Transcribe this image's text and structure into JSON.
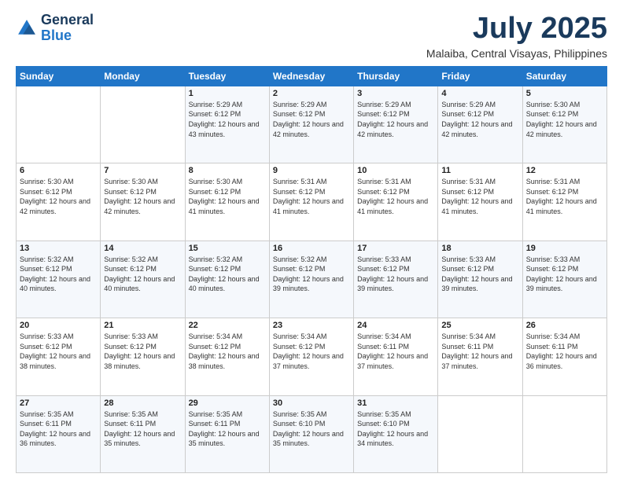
{
  "logo": {
    "text_general": "General",
    "text_blue": "Blue"
  },
  "title": "July 2025",
  "location": "Malaiba, Central Visayas, Philippines",
  "days_of_week": [
    "Sunday",
    "Monday",
    "Tuesday",
    "Wednesday",
    "Thursday",
    "Friday",
    "Saturday"
  ],
  "weeks": [
    [
      {
        "day": "",
        "sunrise": "",
        "sunset": "",
        "daylight": ""
      },
      {
        "day": "",
        "sunrise": "",
        "sunset": "",
        "daylight": ""
      },
      {
        "day": "1",
        "sunrise": "Sunrise: 5:29 AM",
        "sunset": "Sunset: 6:12 PM",
        "daylight": "Daylight: 12 hours and 43 minutes."
      },
      {
        "day": "2",
        "sunrise": "Sunrise: 5:29 AM",
        "sunset": "Sunset: 6:12 PM",
        "daylight": "Daylight: 12 hours and 42 minutes."
      },
      {
        "day": "3",
        "sunrise": "Sunrise: 5:29 AM",
        "sunset": "Sunset: 6:12 PM",
        "daylight": "Daylight: 12 hours and 42 minutes."
      },
      {
        "day": "4",
        "sunrise": "Sunrise: 5:29 AM",
        "sunset": "Sunset: 6:12 PM",
        "daylight": "Daylight: 12 hours and 42 minutes."
      },
      {
        "day": "5",
        "sunrise": "Sunrise: 5:30 AM",
        "sunset": "Sunset: 6:12 PM",
        "daylight": "Daylight: 12 hours and 42 minutes."
      }
    ],
    [
      {
        "day": "6",
        "sunrise": "Sunrise: 5:30 AM",
        "sunset": "Sunset: 6:12 PM",
        "daylight": "Daylight: 12 hours and 42 minutes."
      },
      {
        "day": "7",
        "sunrise": "Sunrise: 5:30 AM",
        "sunset": "Sunset: 6:12 PM",
        "daylight": "Daylight: 12 hours and 42 minutes."
      },
      {
        "day": "8",
        "sunrise": "Sunrise: 5:30 AM",
        "sunset": "Sunset: 6:12 PM",
        "daylight": "Daylight: 12 hours and 41 minutes."
      },
      {
        "day": "9",
        "sunrise": "Sunrise: 5:31 AM",
        "sunset": "Sunset: 6:12 PM",
        "daylight": "Daylight: 12 hours and 41 minutes."
      },
      {
        "day": "10",
        "sunrise": "Sunrise: 5:31 AM",
        "sunset": "Sunset: 6:12 PM",
        "daylight": "Daylight: 12 hours and 41 minutes."
      },
      {
        "day": "11",
        "sunrise": "Sunrise: 5:31 AM",
        "sunset": "Sunset: 6:12 PM",
        "daylight": "Daylight: 12 hours and 41 minutes."
      },
      {
        "day": "12",
        "sunrise": "Sunrise: 5:31 AM",
        "sunset": "Sunset: 6:12 PM",
        "daylight": "Daylight: 12 hours and 41 minutes."
      }
    ],
    [
      {
        "day": "13",
        "sunrise": "Sunrise: 5:32 AM",
        "sunset": "Sunset: 6:12 PM",
        "daylight": "Daylight: 12 hours and 40 minutes."
      },
      {
        "day": "14",
        "sunrise": "Sunrise: 5:32 AM",
        "sunset": "Sunset: 6:12 PM",
        "daylight": "Daylight: 12 hours and 40 minutes."
      },
      {
        "day": "15",
        "sunrise": "Sunrise: 5:32 AM",
        "sunset": "Sunset: 6:12 PM",
        "daylight": "Daylight: 12 hours and 40 minutes."
      },
      {
        "day": "16",
        "sunrise": "Sunrise: 5:32 AM",
        "sunset": "Sunset: 6:12 PM",
        "daylight": "Daylight: 12 hours and 39 minutes."
      },
      {
        "day": "17",
        "sunrise": "Sunrise: 5:33 AM",
        "sunset": "Sunset: 6:12 PM",
        "daylight": "Daylight: 12 hours and 39 minutes."
      },
      {
        "day": "18",
        "sunrise": "Sunrise: 5:33 AM",
        "sunset": "Sunset: 6:12 PM",
        "daylight": "Daylight: 12 hours and 39 minutes."
      },
      {
        "day": "19",
        "sunrise": "Sunrise: 5:33 AM",
        "sunset": "Sunset: 6:12 PM",
        "daylight": "Daylight: 12 hours and 39 minutes."
      }
    ],
    [
      {
        "day": "20",
        "sunrise": "Sunrise: 5:33 AM",
        "sunset": "Sunset: 6:12 PM",
        "daylight": "Daylight: 12 hours and 38 minutes."
      },
      {
        "day": "21",
        "sunrise": "Sunrise: 5:33 AM",
        "sunset": "Sunset: 6:12 PM",
        "daylight": "Daylight: 12 hours and 38 minutes."
      },
      {
        "day": "22",
        "sunrise": "Sunrise: 5:34 AM",
        "sunset": "Sunset: 6:12 PM",
        "daylight": "Daylight: 12 hours and 38 minutes."
      },
      {
        "day": "23",
        "sunrise": "Sunrise: 5:34 AM",
        "sunset": "Sunset: 6:12 PM",
        "daylight": "Daylight: 12 hours and 37 minutes."
      },
      {
        "day": "24",
        "sunrise": "Sunrise: 5:34 AM",
        "sunset": "Sunset: 6:11 PM",
        "daylight": "Daylight: 12 hours and 37 minutes."
      },
      {
        "day": "25",
        "sunrise": "Sunrise: 5:34 AM",
        "sunset": "Sunset: 6:11 PM",
        "daylight": "Daylight: 12 hours and 37 minutes."
      },
      {
        "day": "26",
        "sunrise": "Sunrise: 5:34 AM",
        "sunset": "Sunset: 6:11 PM",
        "daylight": "Daylight: 12 hours and 36 minutes."
      }
    ],
    [
      {
        "day": "27",
        "sunrise": "Sunrise: 5:35 AM",
        "sunset": "Sunset: 6:11 PM",
        "daylight": "Daylight: 12 hours and 36 minutes."
      },
      {
        "day": "28",
        "sunrise": "Sunrise: 5:35 AM",
        "sunset": "Sunset: 6:11 PM",
        "daylight": "Daylight: 12 hours and 35 minutes."
      },
      {
        "day": "29",
        "sunrise": "Sunrise: 5:35 AM",
        "sunset": "Sunset: 6:11 PM",
        "daylight": "Daylight: 12 hours and 35 minutes."
      },
      {
        "day": "30",
        "sunrise": "Sunrise: 5:35 AM",
        "sunset": "Sunset: 6:10 PM",
        "daylight": "Daylight: 12 hours and 35 minutes."
      },
      {
        "day": "31",
        "sunrise": "Sunrise: 5:35 AM",
        "sunset": "Sunset: 6:10 PM",
        "daylight": "Daylight: 12 hours and 34 minutes."
      },
      {
        "day": "",
        "sunrise": "",
        "sunset": "",
        "daylight": ""
      },
      {
        "day": "",
        "sunrise": "",
        "sunset": "",
        "daylight": ""
      }
    ]
  ]
}
